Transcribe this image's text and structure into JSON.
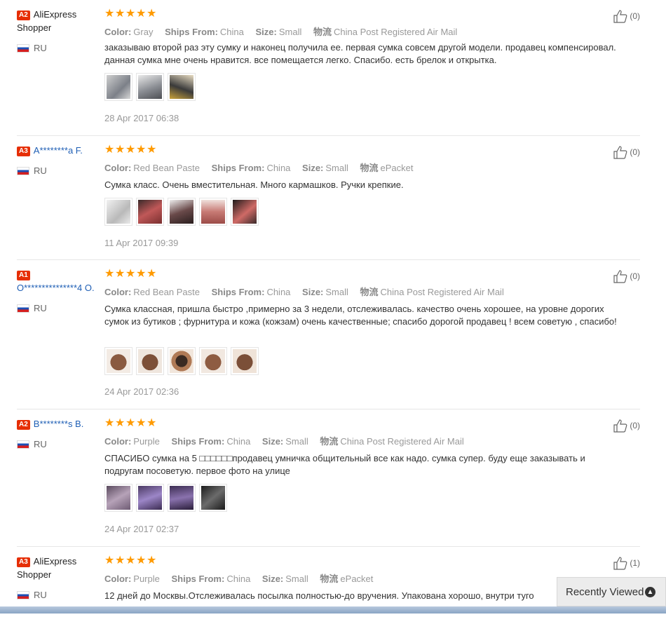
{
  "reviews": [
    {
      "badge": "A2",
      "name": "AliExpress Shopper",
      "country": "RU",
      "color_label": "Color:",
      "color": "Gray",
      "ships_label": "Ships From:",
      "ships": "China",
      "size_label": "Size:",
      "size": "Small",
      "logistics_label": "物流",
      "logistics": "China Post Registered Air Mail",
      "text": "заказываю второй раз эту сумку и наконец получила ее. первая сумка совсем другой модели. продавец компенсировал. данная сумка мне очень нравится. все помещается легко. Спасибо. есть брелок и открытка.",
      "date": "28 Apr 2017 06:38",
      "likes": "(0)"
    },
    {
      "badge": "A3",
      "name": "A********a F.",
      "country": "RU",
      "color_label": "Color:",
      "color": "Red Bean Paste",
      "ships_label": "Ships From:",
      "ships": "China",
      "size_label": "Size:",
      "size": "Small",
      "logistics_label": "物流",
      "logistics": "ePacket",
      "text": "Сумка класс. Очень вместительная. Много кармашков. Ручки крепкие.",
      "date": "11 Apr 2017 09:39",
      "likes": "(0)"
    },
    {
      "badge": "A1",
      "name": "O***************4 O.",
      "country": "RU",
      "color_label": "Color:",
      "color": "Red Bean Paste",
      "ships_label": "Ships From:",
      "ships": "China",
      "size_label": "Size:",
      "size": "Small",
      "logistics_label": "物流",
      "logistics": "China Post Registered Air Mail",
      "text": "Сумка классная, пришла быстро ,примерно за 3 недели, отслеживалась. качество очень хорошее, на уровне дорогих сумок из бутиков ; фурнитура и кожа (кожзам) очень качественные; спасибо дорогой продавец ! всем советую , спасибо!",
      "date": "24 Apr 2017 02:36",
      "likes": "(0)"
    },
    {
      "badge": "A2",
      "name": "B********s B.",
      "country": "RU",
      "color_label": "Color:",
      "color": "Purple",
      "ships_label": "Ships From:",
      "ships": "China",
      "size_label": "Size:",
      "size": "Small",
      "logistics_label": "物流",
      "logistics": "China Post Registered Air Mail",
      "text": "СПАСИБО сумка на 5 □□□□□□продавец умничка общительный все как надо. сумка супер. буду еще заказывать и подругам посоветую. первое фото на улице",
      "date": "24 Apr 2017 02:37",
      "likes": "(0)"
    },
    {
      "badge": "A3",
      "name": "AliExpress Shopper",
      "country": "RU",
      "color_label": "Color:",
      "color": "Purple",
      "ships_label": "Ships From:",
      "ships": "China",
      "size_label": "Size:",
      "size": "Small",
      "logistics_label": "物流",
      "logistics": "ePacket",
      "text": "12 дней до Москвы.Отслеживалась посылка полностью-до вручения. Упакована хорошо, внутри туго",
      "date": "",
      "likes": "(1)"
    }
  ],
  "recently_viewed": {
    "label": "Recently Viewed"
  },
  "colors": {
    "accent_badge": "#e62e04",
    "stars": "#ff9a00",
    "link": "#1f5fb5"
  }
}
